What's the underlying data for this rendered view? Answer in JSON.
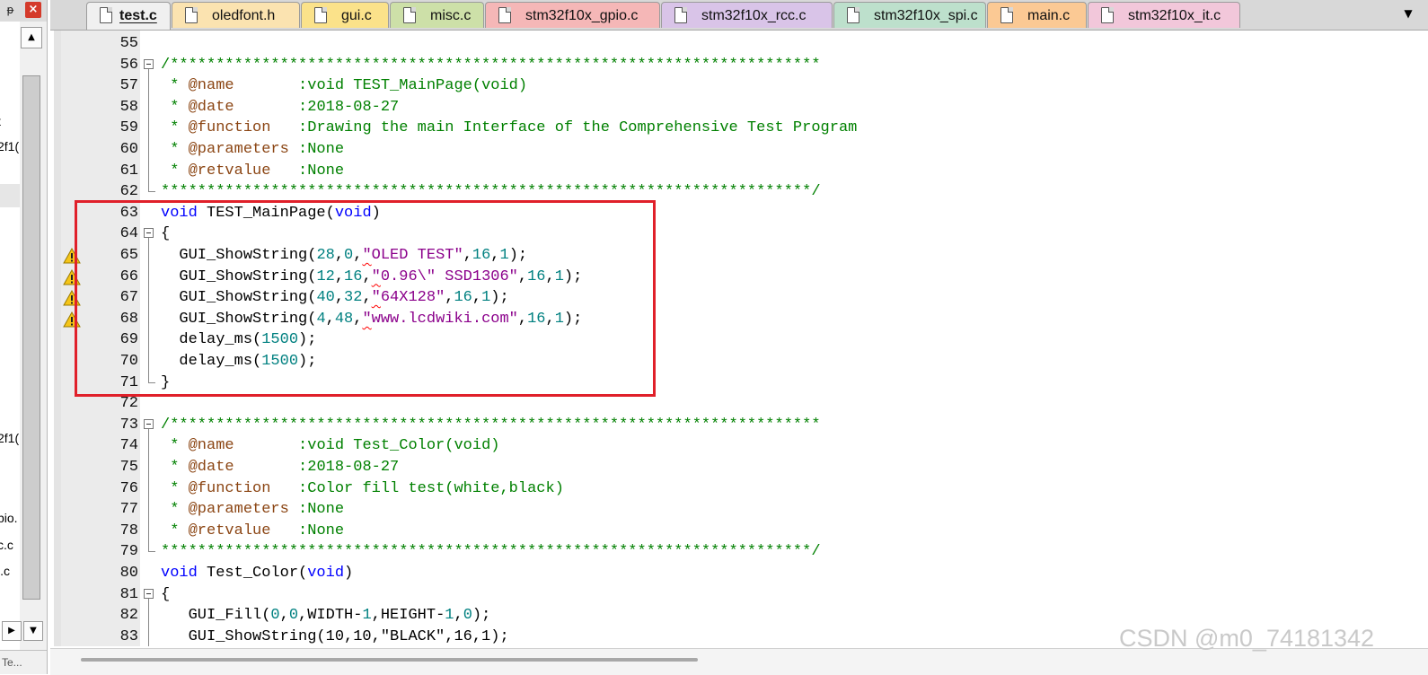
{
  "project_panel": {
    "pin_icon": "pin-icon",
    "close_icon": "close-icon",
    "close_label": "×",
    "pin_label": "ᵽ",
    "tree_items": [
      {
        "label": "t"
      },
      {
        "label": "2f1("
      },
      {
        "label": "2f1("
      },
      {
        "label": "pio."
      },
      {
        "label": "c.c"
      },
      {
        "label": "i.c"
      }
    ],
    "scroll_up_label": "▲",
    "scroll_right_label": "▶",
    "scroll_down_label": "▼",
    "bottom_tab_label": "Te..."
  },
  "tabs": [
    {
      "label": "test.c",
      "color": "#f0f0f0",
      "active": true
    },
    {
      "label": "oledfont.h",
      "color": "#fbe3b0"
    },
    {
      "label": "gui.c",
      "color": "#fbe28a"
    },
    {
      "label": "misc.c",
      "color": "#cde0a8"
    },
    {
      "label": "stm32f10x_gpio.c",
      "color": "#f5b7b7"
    },
    {
      "label": "stm32f10x_rcc.c",
      "color": "#d9c4e8"
    },
    {
      "label": "stm32f10x_spi.c",
      "color": "#bde0cc"
    },
    {
      "label": "main.c",
      "color": "#fbc994"
    },
    {
      "label": "stm32f10x_it.c",
      "color": "#f2c7da"
    }
  ],
  "tab_menu_label": "▼",
  "code_lines": [
    {
      "n": "55",
      "segs": []
    },
    {
      "n": "56",
      "fold": "start",
      "segs": [
        {
          "t": "/***********************************************************************",
          "c": "comment"
        }
      ]
    },
    {
      "n": "57",
      "segs": [
        {
          "t": " * ",
          "c": "comment"
        },
        {
          "t": "@name",
          "c": "tag"
        },
        {
          "t": "       :void TEST_MainPage(void)",
          "c": "comment"
        }
      ]
    },
    {
      "n": "58",
      "segs": [
        {
          "t": " * ",
          "c": "comment"
        },
        {
          "t": "@date",
          "c": "tag"
        },
        {
          "t": "       :2018-08-27",
          "c": "comment"
        }
      ]
    },
    {
      "n": "59",
      "segs": [
        {
          "t": " * ",
          "c": "comment"
        },
        {
          "t": "@function",
          "c": "tag"
        },
        {
          "t": "   :Drawing the main Interface of the Comprehensive Test Program",
          "c": "comment"
        }
      ]
    },
    {
      "n": "60",
      "segs": [
        {
          "t": " * ",
          "c": "comment"
        },
        {
          "t": "@parameters",
          "c": "tag"
        },
        {
          "t": " :None",
          "c": "comment"
        }
      ]
    },
    {
      "n": "61",
      "segs": [
        {
          "t": " * ",
          "c": "comment"
        },
        {
          "t": "@retvalue",
          "c": "tag"
        },
        {
          "t": "   :None",
          "c": "comment"
        }
      ]
    },
    {
      "n": "62",
      "fold": "end",
      "segs": [
        {
          "t": "***********************************************************************/",
          "c": "comment"
        }
      ]
    },
    {
      "n": "63",
      "segs": [
        {
          "t": "void",
          "c": "kw"
        },
        {
          "t": " TEST_MainPage(",
          "c": "plain"
        },
        {
          "t": "void",
          "c": "kw"
        },
        {
          "t": ")",
          "c": "plain"
        }
      ]
    },
    {
      "n": "64",
      "fold": "start",
      "segs": [
        {
          "t": "{",
          "c": "plain"
        }
      ]
    },
    {
      "n": "65",
      "warn": true,
      "segs": [
        {
          "t": "  GUI_ShowString(",
          "c": "plain"
        },
        {
          "t": "28",
          "c": "num"
        },
        {
          "t": ",",
          "c": "plain"
        },
        {
          "t": "0",
          "c": "num"
        },
        {
          "t": ",",
          "c": "plain"
        },
        {
          "t": "\"",
          "c": "str",
          "sq": true
        },
        {
          "t": "OLED TEST\"",
          "c": "str"
        },
        {
          "t": ",",
          "c": "plain"
        },
        {
          "t": "16",
          "c": "num"
        },
        {
          "t": ",",
          "c": "plain"
        },
        {
          "t": "1",
          "c": "num"
        },
        {
          "t": ");",
          "c": "plain"
        }
      ]
    },
    {
      "n": "66",
      "warn": true,
      "segs": [
        {
          "t": "  GUI_ShowString(",
          "c": "plain"
        },
        {
          "t": "12",
          "c": "num"
        },
        {
          "t": ",",
          "c": "plain"
        },
        {
          "t": "16",
          "c": "num"
        },
        {
          "t": ",",
          "c": "plain"
        },
        {
          "t": "\"",
          "c": "str",
          "sq": true
        },
        {
          "t": "0.96\\\" SSD1306\"",
          "c": "str"
        },
        {
          "t": ",",
          "c": "plain"
        },
        {
          "t": "16",
          "c": "num"
        },
        {
          "t": ",",
          "c": "plain"
        },
        {
          "t": "1",
          "c": "num"
        },
        {
          "t": ");",
          "c": "plain"
        }
      ]
    },
    {
      "n": "67",
      "warn": true,
      "segs": [
        {
          "t": "  GUI_ShowString(",
          "c": "plain"
        },
        {
          "t": "40",
          "c": "num"
        },
        {
          "t": ",",
          "c": "plain"
        },
        {
          "t": "32",
          "c": "num"
        },
        {
          "t": ",",
          "c": "plain"
        },
        {
          "t": "\"",
          "c": "str",
          "sq": true
        },
        {
          "t": "64X128\"",
          "c": "str"
        },
        {
          "t": ",",
          "c": "plain"
        },
        {
          "t": "16",
          "c": "num"
        },
        {
          "t": ",",
          "c": "plain"
        },
        {
          "t": "1",
          "c": "num"
        },
        {
          "t": ");",
          "c": "plain"
        }
      ]
    },
    {
      "n": "68",
      "warn": true,
      "segs": [
        {
          "t": "  GUI_ShowString(",
          "c": "plain"
        },
        {
          "t": "4",
          "c": "num"
        },
        {
          "t": ",",
          "c": "plain"
        },
        {
          "t": "48",
          "c": "num"
        },
        {
          "t": ",",
          "c": "plain"
        },
        {
          "t": "\"",
          "c": "str",
          "sq": true
        },
        {
          "t": "www.lcdwiki.com\"",
          "c": "str"
        },
        {
          "t": ",",
          "c": "plain"
        },
        {
          "t": "16",
          "c": "num"
        },
        {
          "t": ",",
          "c": "plain"
        },
        {
          "t": "1",
          "c": "num"
        },
        {
          "t": ");",
          "c": "plain"
        }
      ]
    },
    {
      "n": "69",
      "segs": [
        {
          "t": "  delay_ms(",
          "c": "plain"
        },
        {
          "t": "1500",
          "c": "num"
        },
        {
          "t": ");",
          "c": "plain"
        }
      ]
    },
    {
      "n": "70",
      "segs": [
        {
          "t": "  delay_ms(",
          "c": "plain"
        },
        {
          "t": "1500",
          "c": "num"
        },
        {
          "t": ");",
          "c": "plain"
        }
      ]
    },
    {
      "n": "71",
      "fold": "end",
      "segs": [
        {
          "t": "}",
          "c": "plain"
        }
      ]
    },
    {
      "n": "72",
      "segs": []
    },
    {
      "n": "73",
      "fold": "start",
      "segs": [
        {
          "t": "/***********************************************************************",
          "c": "comment"
        }
      ]
    },
    {
      "n": "74",
      "segs": [
        {
          "t": " * ",
          "c": "comment"
        },
        {
          "t": "@name",
          "c": "tag"
        },
        {
          "t": "       :void Test_Color(void)",
          "c": "comment"
        }
      ]
    },
    {
      "n": "75",
      "segs": [
        {
          "t": " * ",
          "c": "comment"
        },
        {
          "t": "@date",
          "c": "tag"
        },
        {
          "t": "       :2018-08-27",
          "c": "comment"
        }
      ]
    },
    {
      "n": "76",
      "segs": [
        {
          "t": " * ",
          "c": "comment"
        },
        {
          "t": "@function",
          "c": "tag"
        },
        {
          "t": "   :Color fill test(white,black)",
          "c": "comment"
        }
      ]
    },
    {
      "n": "77",
      "segs": [
        {
          "t": " * ",
          "c": "comment"
        },
        {
          "t": "@parameters",
          "c": "tag"
        },
        {
          "t": " :None",
          "c": "comment"
        }
      ]
    },
    {
      "n": "78",
      "segs": [
        {
          "t": " * ",
          "c": "comment"
        },
        {
          "t": "@retvalue",
          "c": "tag"
        },
        {
          "t": "   :None",
          "c": "comment"
        }
      ]
    },
    {
      "n": "79",
      "fold": "end",
      "segs": [
        {
          "t": "***********************************************************************/",
          "c": "comment"
        }
      ]
    },
    {
      "n": "80",
      "segs": [
        {
          "t": "void",
          "c": "kw"
        },
        {
          "t": " Test_Color(",
          "c": "plain"
        },
        {
          "t": "void",
          "c": "kw"
        },
        {
          "t": ")",
          "c": "plain"
        }
      ]
    },
    {
      "n": "81",
      "fold": "start",
      "segs": [
        {
          "t": "{",
          "c": "plain"
        }
      ]
    },
    {
      "n": "82",
      "segs": [
        {
          "t": "   GUI_Fill(",
          "c": "plain"
        },
        {
          "t": "0",
          "c": "num"
        },
        {
          "t": ",",
          "c": "plain"
        },
        {
          "t": "0",
          "c": "num"
        },
        {
          "t": ",WIDTH-",
          "c": "plain"
        },
        {
          "t": "1",
          "c": "num"
        },
        {
          "t": ",HEIGHT-",
          "c": "plain"
        },
        {
          "t": "1",
          "c": "num"
        },
        {
          "t": ",",
          "c": "plain"
        },
        {
          "t": "0",
          "c": "num"
        },
        {
          "t": ");",
          "c": "plain"
        }
      ]
    },
    {
      "n": "83",
      "segs": [
        {
          "t": "   GUI_ShowString(10,10,\"BLACK\",16,1);",
          "c": "plain"
        }
      ]
    }
  ],
  "colors": {
    "comment": "#008000",
    "keyword": "#0000ff",
    "number": "#008080",
    "string": "#8b008b",
    "doc_tag": "#8b4513",
    "highlight_border": "#e0202a"
  },
  "watermark": "CSDN @m0_74181342"
}
